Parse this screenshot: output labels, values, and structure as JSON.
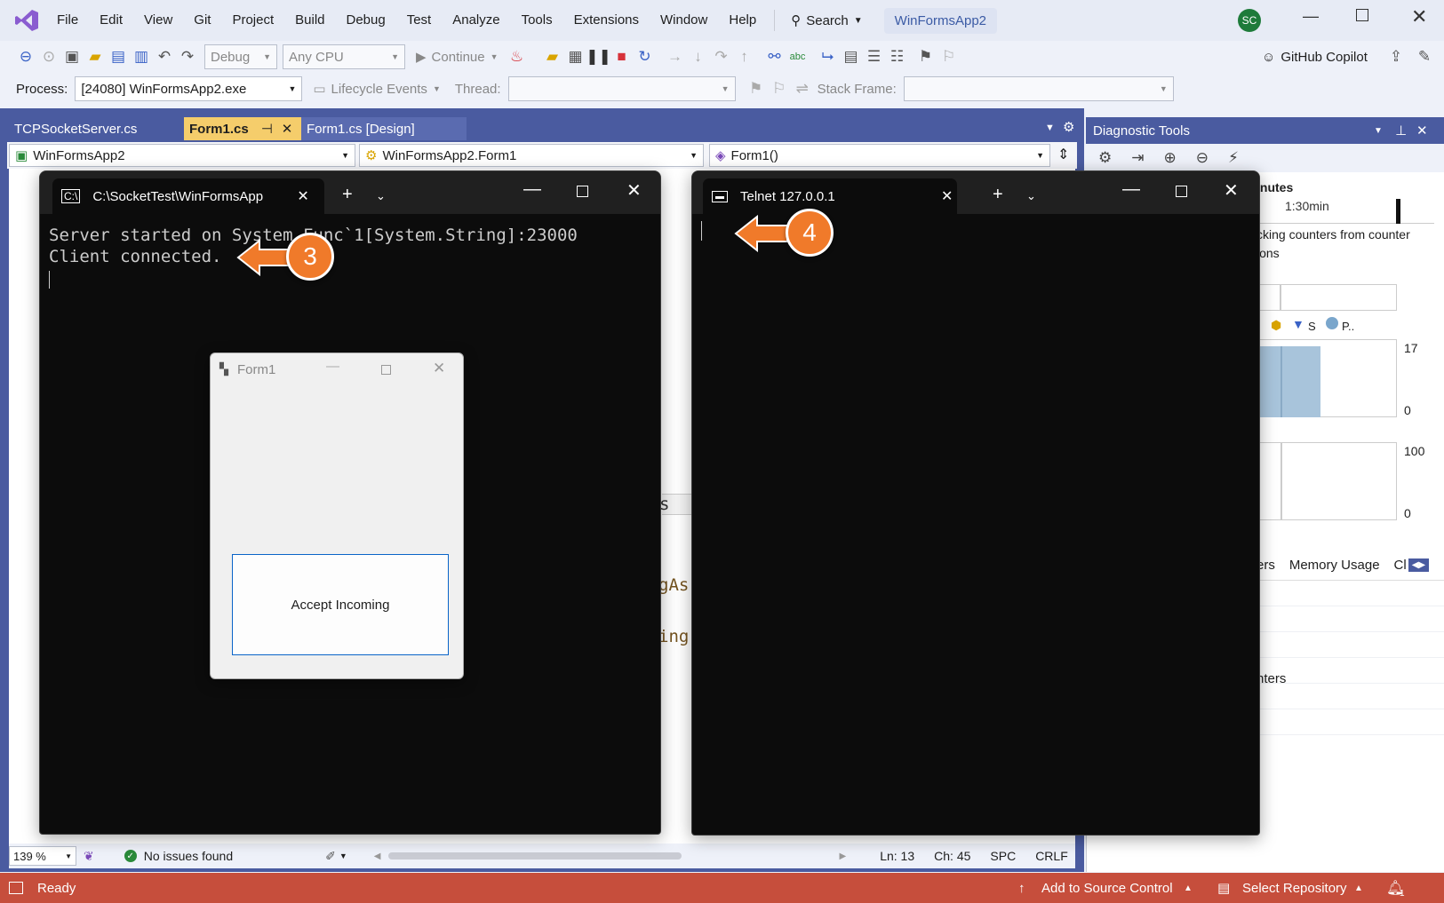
{
  "menu": [
    "File",
    "Edit",
    "View",
    "Git",
    "Project",
    "Build",
    "Debug",
    "Test",
    "Analyze",
    "Tools",
    "Extensions",
    "Window",
    "Help"
  ],
  "search_label": "Search",
  "solution_name": "WinFormsApp2",
  "avatar_initials": "SC",
  "toolbar": {
    "config": "Debug",
    "platform": "Any CPU",
    "continue_label": "Continue",
    "copilot_label": "GitHub Copilot"
  },
  "debug_bar": {
    "process_label": "Process:",
    "process_value": "[24080] WinFormsApp2.exe",
    "lifecycle_label": "Lifecycle Events",
    "thread_label": "Thread:",
    "stack_frame_label": "Stack Frame:"
  },
  "doc_tabs": [
    {
      "label": "TCPSocketServer.cs"
    },
    {
      "label": "Form1.cs"
    },
    {
      "label": "Form1.cs [Design]"
    }
  ],
  "nav_bar": {
    "project": "WinFormsApp2",
    "class": "WinFormsApp2.Form1",
    "member": "Form1()"
  },
  "code_fragments": [
    "s",
    "gAs",
    "ing"
  ],
  "editor_status": {
    "zoom": "139 %",
    "issues": "No issues found",
    "line": "Ln: 13",
    "col": "Ch: 45",
    "spacing": "SPC",
    "eol": "CRLF"
  },
  "diagnostic": {
    "title": "Diagnostic Tools",
    "session_suffix": "inutes",
    "time_tick": "1:30min",
    "msg_line1": "cking counters from counter",
    "msg_line2": "ions",
    "legend_s": "S",
    "legend_p": "P..",
    "chart1_max": "17",
    "chart1_min": "0",
    "chart2_max": "100",
    "chart2_min": "0",
    "tab_partial": "ers",
    "tab_memory": "Memory Usage",
    "tab_cut": "Cl",
    "list_item": "nters"
  },
  "terminal1": {
    "title": "C:\\SocketTest\\WinFormsApp",
    "line1": "Server started on System.Func`1[System.String]:23000",
    "line2": "Client connected."
  },
  "terminal2": {
    "title": "Telnet 127.0.0.1"
  },
  "form1": {
    "title": "Form1",
    "button": "Accept Incoming"
  },
  "callouts": {
    "c3": "3",
    "c4": "4"
  },
  "statusbar": {
    "ready": "Ready",
    "source_control": "Add to Source Control",
    "repository": "Select Repository",
    "notifications": "1"
  }
}
